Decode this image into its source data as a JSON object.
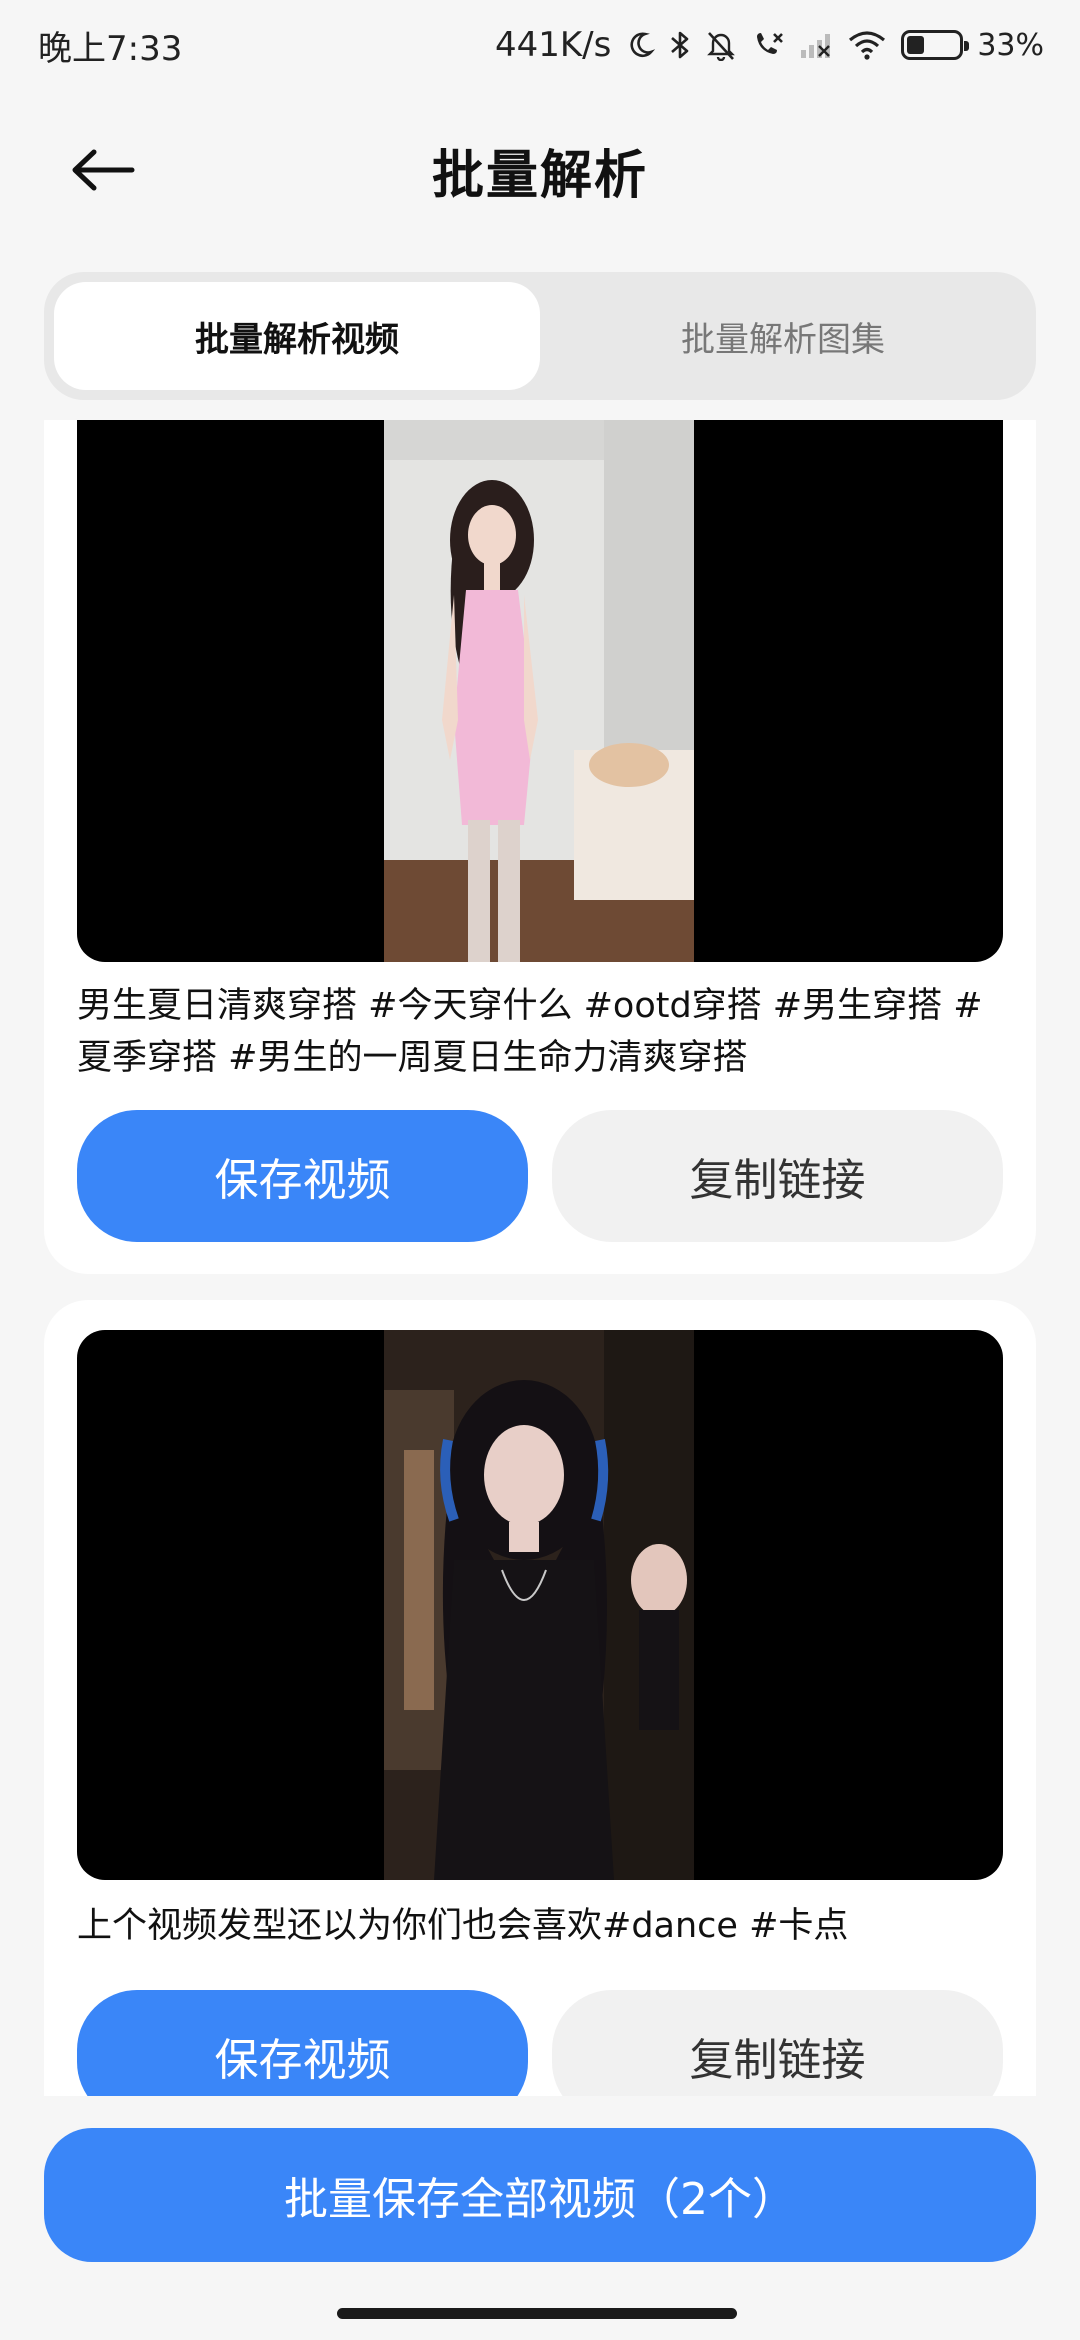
{
  "status_bar": {
    "time": "晚上7:33",
    "net_speed": "441K/s",
    "battery_percent": "33%",
    "battery_level": 0.33,
    "icons": [
      "moon-icon",
      "bluetooth-icon",
      "mute-icon",
      "missed-call-icon",
      "signal-icon",
      "wifi-icon",
      "battery-icon"
    ]
  },
  "header": {
    "back_icon": "arrow-left-icon",
    "title": "批量解析"
  },
  "tabs": [
    {
      "label": "批量解析视频",
      "active": true
    },
    {
      "label": "批量解析图集",
      "active": false
    }
  ],
  "videos": [
    {
      "caption": "男生夏日清爽穿搭 #今天穿什么 #ootd穿搭 #男生穿搭 #夏季穿搭 #男生的一周夏日生命力清爽穿搭",
      "save_label": "保存视频",
      "copy_label": "复制链接"
    },
    {
      "caption": "上个视频发型还以为你们也会喜欢#dance #卡点",
      "save_label": "保存视频",
      "copy_label": "复制链接"
    }
  ],
  "bottom_action": {
    "label": "批量保存全部视频（2个）"
  },
  "colors": {
    "accent": "#3a86f8",
    "background": "#f6f6f6",
    "card": "#ffffff",
    "secondary_button": "#f1f1f1"
  }
}
